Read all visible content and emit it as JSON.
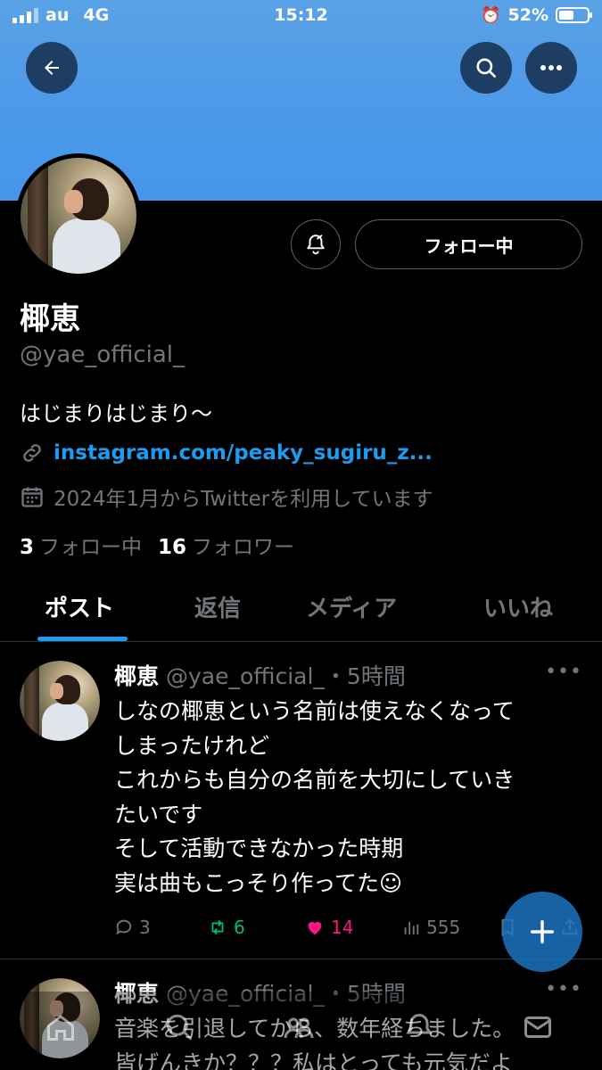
{
  "status_bar": {
    "carrier": "au",
    "network": "4G",
    "time": "15:12",
    "battery": "52%",
    "battery_level": 0.52
  },
  "profile": {
    "name": "椰恵",
    "handle": "@yae_official_",
    "bio": "はじまりはじまり〜",
    "link": "instagram.com/peaky_sugiru_z...",
    "joined": "2024年1月からTwitterを利用しています",
    "following_count": "3",
    "following_label": "フォロー中",
    "followers_count": "16",
    "followers_label": "フォロワー",
    "follow_button": "フォロー中"
  },
  "tabs": [
    {
      "label": "ポスト",
      "active": true
    },
    {
      "label": "返信",
      "active": false
    },
    {
      "label": "メディア",
      "active": false
    },
    {
      "label": "いいね",
      "active": false
    }
  ],
  "posts": [
    {
      "name": "椰恵",
      "meta": "@yae_official_・5時間",
      "lines": [
        "しなの椰恵という名前は使えなくなって",
        "しまったけれど",
        "これからも自分の名前を大切にしていき",
        "たいです",
        "そして活動できなかった時期",
        "実は曲もこっそり作ってた☺"
      ],
      "replies": "3",
      "reposts": "6",
      "likes": "14",
      "views": "555"
    },
    {
      "name": "椰恵",
      "meta": "@yae_official_・5時間",
      "lines": [
        "音楽を引退してから、数年経ちました。",
        "皆げんきか？？？私はとっても元気だよ"
      ]
    }
  ],
  "colors": {
    "accent": "#1d9bf0",
    "banner": "#4b98e8",
    "like": "#f91880",
    "repost": "#00ba7c"
  },
  "icons": [
    "back-arrow-icon",
    "search-icon",
    "more-icon",
    "bell-icon",
    "link-icon",
    "calendar-icon",
    "reply-icon",
    "repost-icon",
    "heart-icon",
    "views-icon",
    "bookmark-icon",
    "share-icon",
    "plus-icon",
    "home-icon",
    "search-nav-icon",
    "communities-icon",
    "notifications-icon",
    "messages-icon"
  ]
}
